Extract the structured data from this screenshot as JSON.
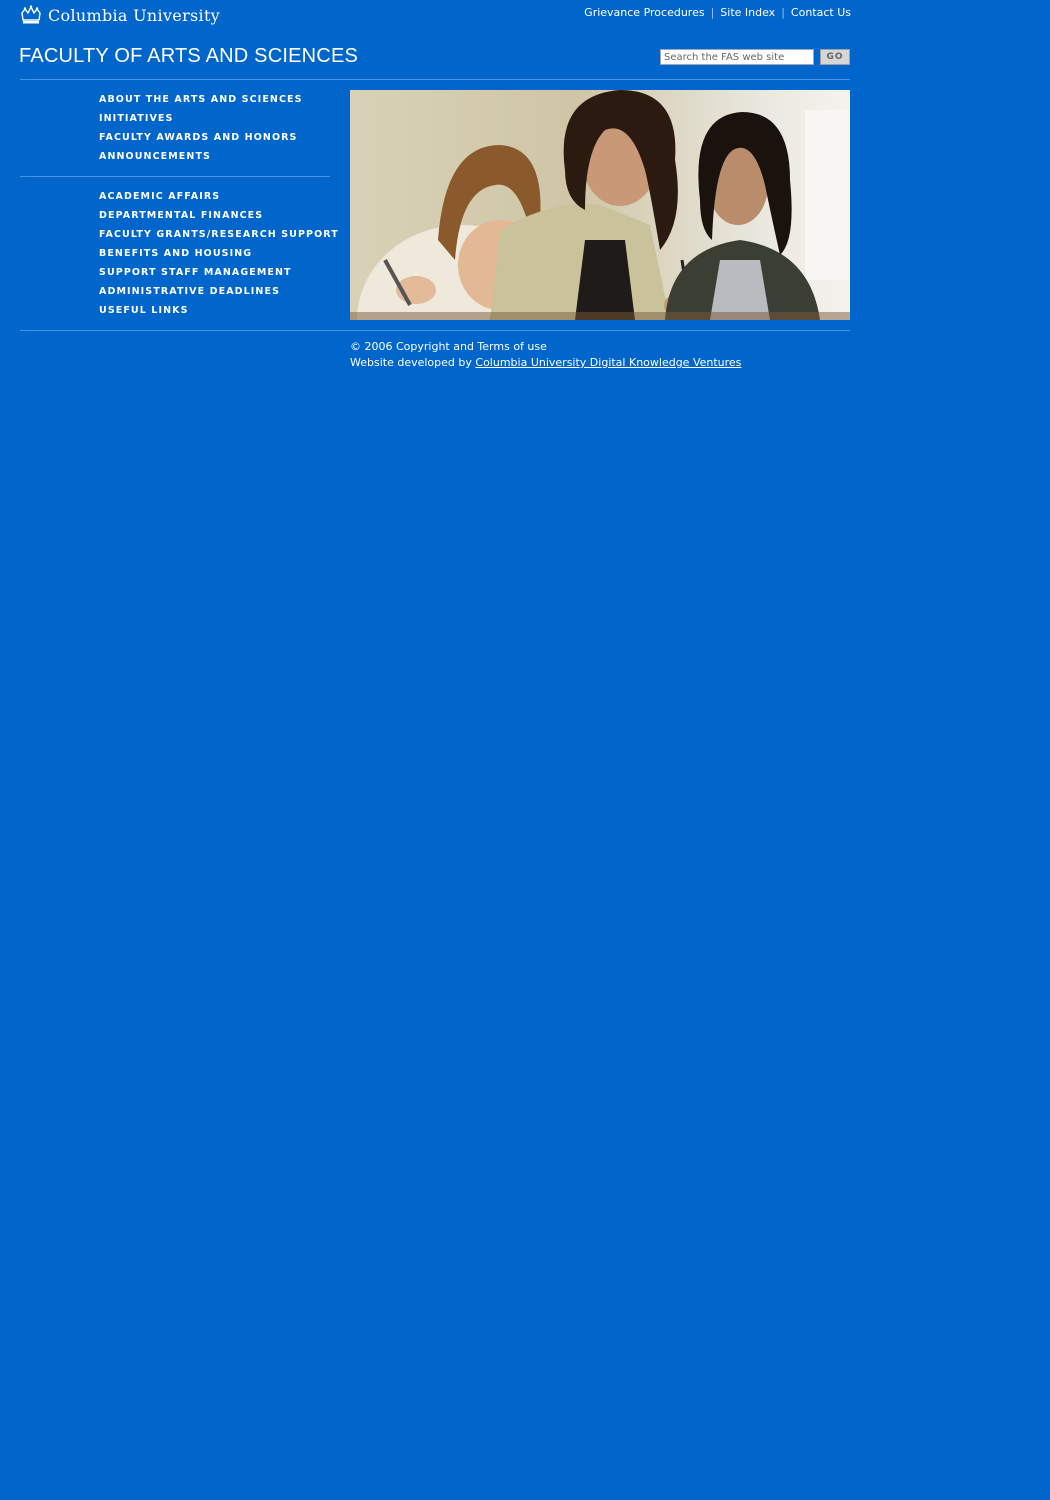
{
  "header": {
    "university_name": "Columbia University",
    "logo_icon": "crown-icon",
    "faculty_title": "FACULTY OF ARTS AND SCIENCES"
  },
  "utility_links": {
    "grievance": "Grievance Procedures",
    "site_index": "Site Index",
    "contact": "Contact Us",
    "separator": "|"
  },
  "search": {
    "placeholder": "Search the FAS web site",
    "button_label": "GO"
  },
  "nav_primary": [
    {
      "label": "ABOUT THE ARTS AND SCIENCES"
    },
    {
      "label": "INITIATIVES"
    },
    {
      "label": "FACULTY AWARDS AND HONORS"
    },
    {
      "label": "ANNOUNCEMENTS"
    }
  ],
  "nav_secondary": [
    {
      "label": "ACADEMIC AFFAIRS"
    },
    {
      "label": "DEPARTMENTAL FINANCES"
    },
    {
      "label": "FACULTY GRANTS/RESEARCH SUPPORT"
    },
    {
      "label": "BENEFITS AND HOUSING"
    },
    {
      "label": "SUPPORT STAFF MANAGEMENT"
    },
    {
      "label": "ADMINISTRATIVE DEADLINES"
    },
    {
      "label": "USEFUL LINKS"
    }
  ],
  "footer": {
    "copyright": "© 2006 Copyright and Terms of use",
    "developed_prefix": "Website developed by",
    "developer_link": "Columbia University Digital Knowledge Ventures"
  },
  "colors": {
    "background": "#0066cc",
    "text": "#ffffff",
    "rule": "#4d94e0"
  }
}
